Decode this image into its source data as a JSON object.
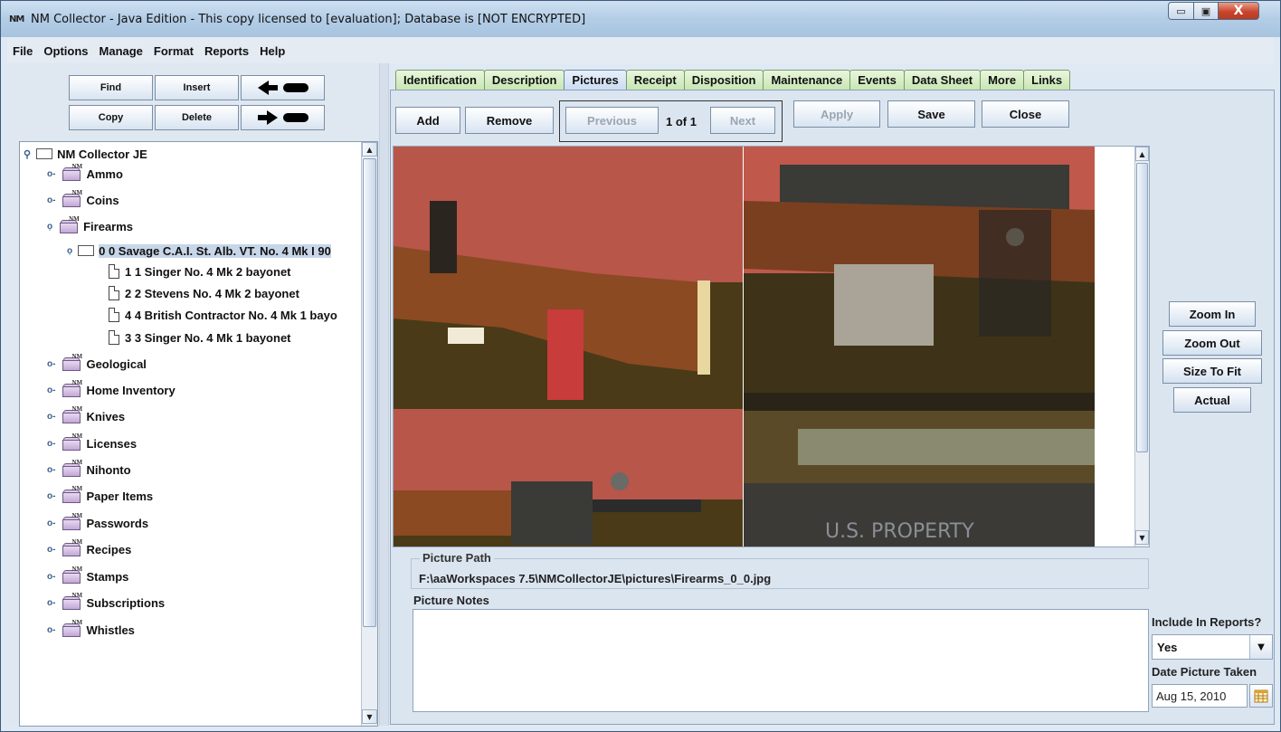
{
  "window": {
    "app_icon": "NM",
    "title": "NM Collector - Java Edition - This copy licensed to [evaluation]; Database is [NOT ENCRYPTED]",
    "min_glyph": "▭",
    "max_glyph": "▣",
    "close_glyph": "X"
  },
  "menu": [
    "File",
    "Options",
    "Manage",
    "Format",
    "Reports",
    "Help"
  ],
  "toolbar": {
    "find": "Find",
    "insert": "Insert",
    "copy": "Copy",
    "delete": "Delete",
    "back_icon": "arrow-left-icon",
    "forward_icon": "arrow-right-icon"
  },
  "tree": {
    "root": "NM Collector JE",
    "folder_badge": "NM",
    "items": [
      {
        "label": "Ammo"
      },
      {
        "label": "Coins"
      },
      {
        "label": "Firearms"
      },
      {
        "label": "0 0 Savage C.A.I. St. Alb. VT. No. 4 Mk I 90"
      },
      {
        "label": "1 1 Singer No. 4 Mk 2 bayonet"
      },
      {
        "label": "2 2 Stevens No. 4 Mk 2 bayonet"
      },
      {
        "label": "4 4 British Contractor No. 4 Mk 1 bayo"
      },
      {
        "label": "3 3 Singer No. 4 Mk 1 bayonet"
      },
      {
        "label": "Geological"
      },
      {
        "label": "Home Inventory"
      },
      {
        "label": "Knives"
      },
      {
        "label": "Licenses"
      },
      {
        "label": "Nihonto"
      },
      {
        "label": "Paper Items"
      },
      {
        "label": "Passwords"
      },
      {
        "label": "Recipes"
      },
      {
        "label": "Stamps"
      },
      {
        "label": "Subscriptions"
      },
      {
        "label": "Whistles"
      }
    ]
  },
  "tabs": [
    "Identification",
    "Description",
    "Pictures",
    "Receipt",
    "Disposition",
    "Maintenance",
    "Events",
    "Data Sheet",
    "More",
    "Links"
  ],
  "active_tab": "Pictures",
  "pictures": {
    "add": "Add",
    "remove": "Remove",
    "previous": "Previous",
    "pager": "1 of 1",
    "next": "Next",
    "apply": "Apply",
    "save": "Save",
    "close": "Close",
    "zoom_in": "Zoom In",
    "zoom_out": "Zoom Out",
    "size_to_fit": "Size To Fit",
    "actual": "Actual",
    "picture_path_label": "Picture Path",
    "picture_path": "F:\\aaWorkspaces 7.5\\NMCollectorJE\\pictures\\Firearms_0_0.jpg",
    "picture_notes_label": "Picture Notes",
    "picture_notes": "",
    "include_in_reports_label": "Include In Reports?",
    "include_in_reports": "Yes",
    "date_taken_label": "Date Picture Taken",
    "date_taken": "Aug 15, 2010",
    "image_stamp_text": "U.S. PROPERTY"
  },
  "colors": {
    "tab_green": "#c7e6b2",
    "tab_active": "#cbdcf2",
    "selection": "#c7d6e8"
  }
}
